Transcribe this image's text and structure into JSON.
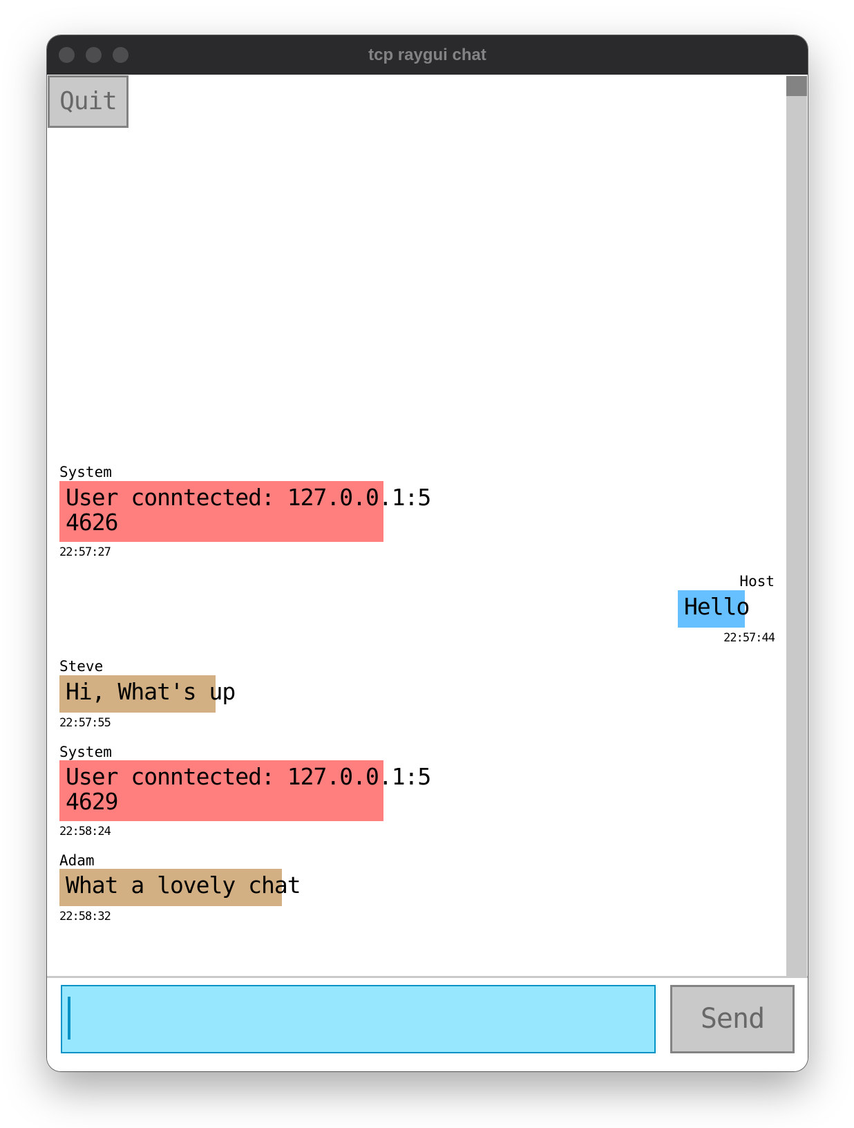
{
  "window": {
    "title": "tcp raygui chat"
  },
  "toolbar": {
    "quit_label": "Quit"
  },
  "messages": [
    {
      "sender": "System",
      "text": "User conntected: 127.0.0.1:5\n4626",
      "time": "22:57:27",
      "kind": "system"
    },
    {
      "sender": "Host",
      "text": "Hello",
      "time": "22:57:44",
      "kind": "host"
    },
    {
      "sender": "Steve",
      "text": "Hi, What's up",
      "time": "22:57:55",
      "kind": "user"
    },
    {
      "sender": "System",
      "text": "User conntected: 127.0.0.1:5\n4629",
      "time": "22:58:24",
      "kind": "system"
    },
    {
      "sender": "Adam",
      "text": "What a lovely chat",
      "time": "22:58:32",
      "kind": "user"
    }
  ],
  "composer": {
    "value": "",
    "send_label": "Send"
  },
  "colors": {
    "system_bubble": "#ff7f7f",
    "user_bubble": "#d2b083",
    "host_bubble": "#66bfff",
    "input_background": "#97e8ff",
    "input_border": "#0492c7",
    "button_background": "#c9c9c9"
  }
}
